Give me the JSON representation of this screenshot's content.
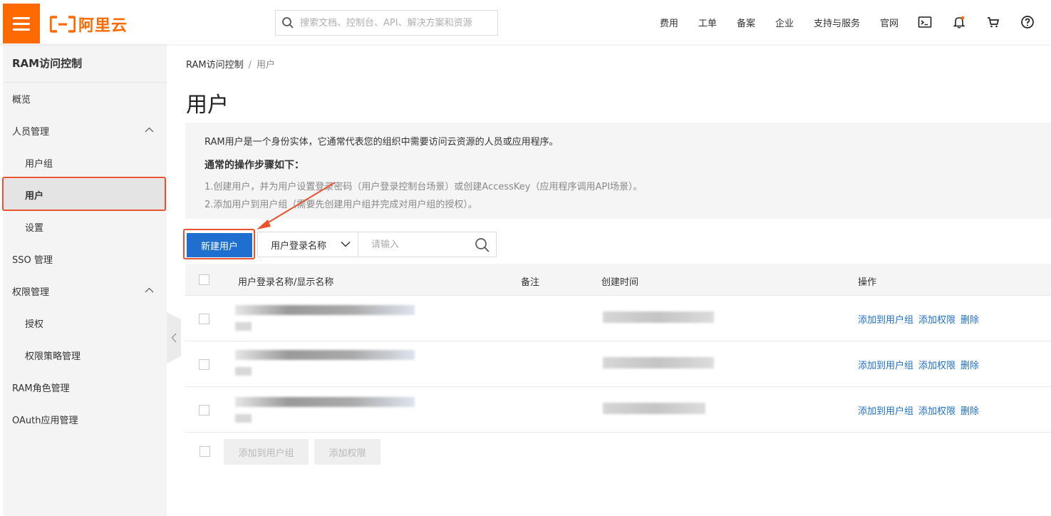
{
  "header": {
    "logo_text": "阿里云",
    "search_placeholder": "搜索文档、控制台、API、解决方案和资源",
    "nav": [
      "费用",
      "工单",
      "备案",
      "企业",
      "支持与服务",
      "官网"
    ],
    "icons": [
      "terminal-icon",
      "bell-icon",
      "cart-icon",
      "help-icon"
    ],
    "accent": "#ff6a00"
  },
  "sidebar": {
    "title": "RAM访问控制",
    "items": [
      {
        "label": "概览"
      },
      {
        "label": "人员管理"
      },
      {
        "label": "用户组"
      },
      {
        "label": "用户"
      },
      {
        "label": "设置"
      },
      {
        "label": "SSO 管理"
      },
      {
        "label": "权限管理"
      },
      {
        "label": "授权"
      },
      {
        "label": "权限策略管理"
      },
      {
        "label": "RAM角色管理"
      },
      {
        "label": "OAuth应用管理"
      }
    ]
  },
  "main": {
    "breadcrumb": {
      "root": "RAM访问控制",
      "sep": "/",
      "current": "用户"
    },
    "title": "用户",
    "info": {
      "desc": "RAM用户是一个身份实体，它通常代表您的组织中需要访问云资源的人员或应用程序。",
      "steps_title": "通常的操作步骤如下：",
      "step1": "1.创建用户，并为用户设置登录密码（用户登录控制台场景）或创建AccessKey（应用程序调用API场景）。",
      "step2": "2.添加用户到用户组（需要先创建用户组并完成对用户组的授权）。"
    },
    "toolbar": {
      "create_label": "新建用户",
      "select_value": "用户登录名称",
      "search_placeholder": "请输入"
    },
    "table": {
      "headers": {
        "name": "用户登录名称/显示名称",
        "note": "备注",
        "created": "创建时间",
        "ops": "操作"
      },
      "rows": [
        {
          "op1": "添加到用户组",
          "op2": "添加权限",
          "op3": "删除"
        },
        {
          "op1": "添加到用户组",
          "op2": "添加权限",
          "op3": "删除"
        },
        {
          "op1": "添加到用户组",
          "op2": "添加权限",
          "op3": "删除"
        }
      ]
    },
    "bulk": {
      "add_group": "添加到用户组",
      "add_perm": "添加权限"
    }
  },
  "colors": {
    "primary": "#1e6fd0",
    "highlight": "#e8542e"
  }
}
